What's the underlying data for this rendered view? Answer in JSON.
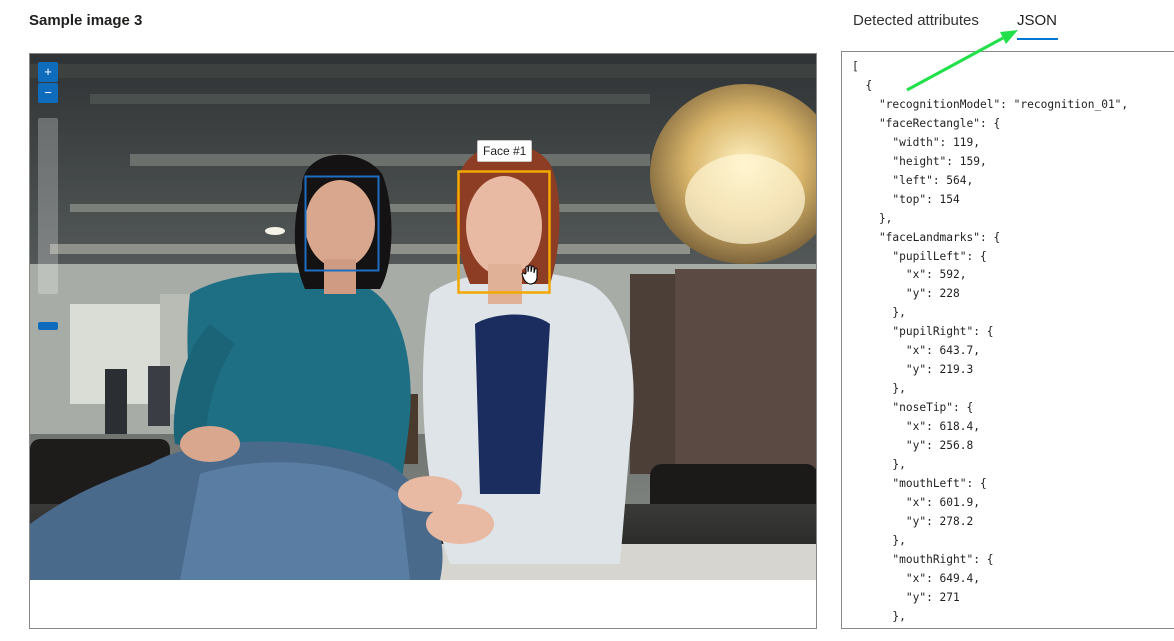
{
  "page": {
    "title": "Sample image 3"
  },
  "tabs": [
    {
      "label": "Detected attributes",
      "selected": false
    },
    {
      "label": "JSON",
      "selected": true
    }
  ],
  "image_viewer": {
    "zoom_in_icon": "plus-icon",
    "zoom_out_icon": "minus-icon",
    "faces": [
      {
        "label": "",
        "color": "#1e6fc2"
      },
      {
        "label": "Face #1",
        "color": "#f2a900"
      }
    ],
    "cursor_icon": "hand-cursor-icon"
  },
  "json_lines": [
    "[",
    "  {",
    "    \"recognitionModel\": \"recognition_01\",",
    "    \"faceRectangle\": {",
    "      \"width\": 119,",
    "      \"height\": 159,",
    "      \"left\": 564,",
    "      \"top\": 154",
    "    },",
    "    \"faceLandmarks\": {",
    "      \"pupilLeft\": {",
    "        \"x\": 592,",
    "        \"y\": 228",
    "      },",
    "      \"pupilRight\": {",
    "        \"x\": 643.7,",
    "        \"y\": 219.3",
    "      },",
    "      \"noseTip\": {",
    "        \"x\": 618.4,",
    "        \"y\": 256.8",
    "      },",
    "      \"mouthLeft\": {",
    "        \"x\": 601.9,",
    "        \"y\": 278.2",
    "      },",
    "      \"mouthRight\": {",
    "        \"x\": 649.4,",
    "        \"y\": 271",
    "      },"
  ],
  "annotation": {
    "arrow_color": "#22e04a"
  }
}
